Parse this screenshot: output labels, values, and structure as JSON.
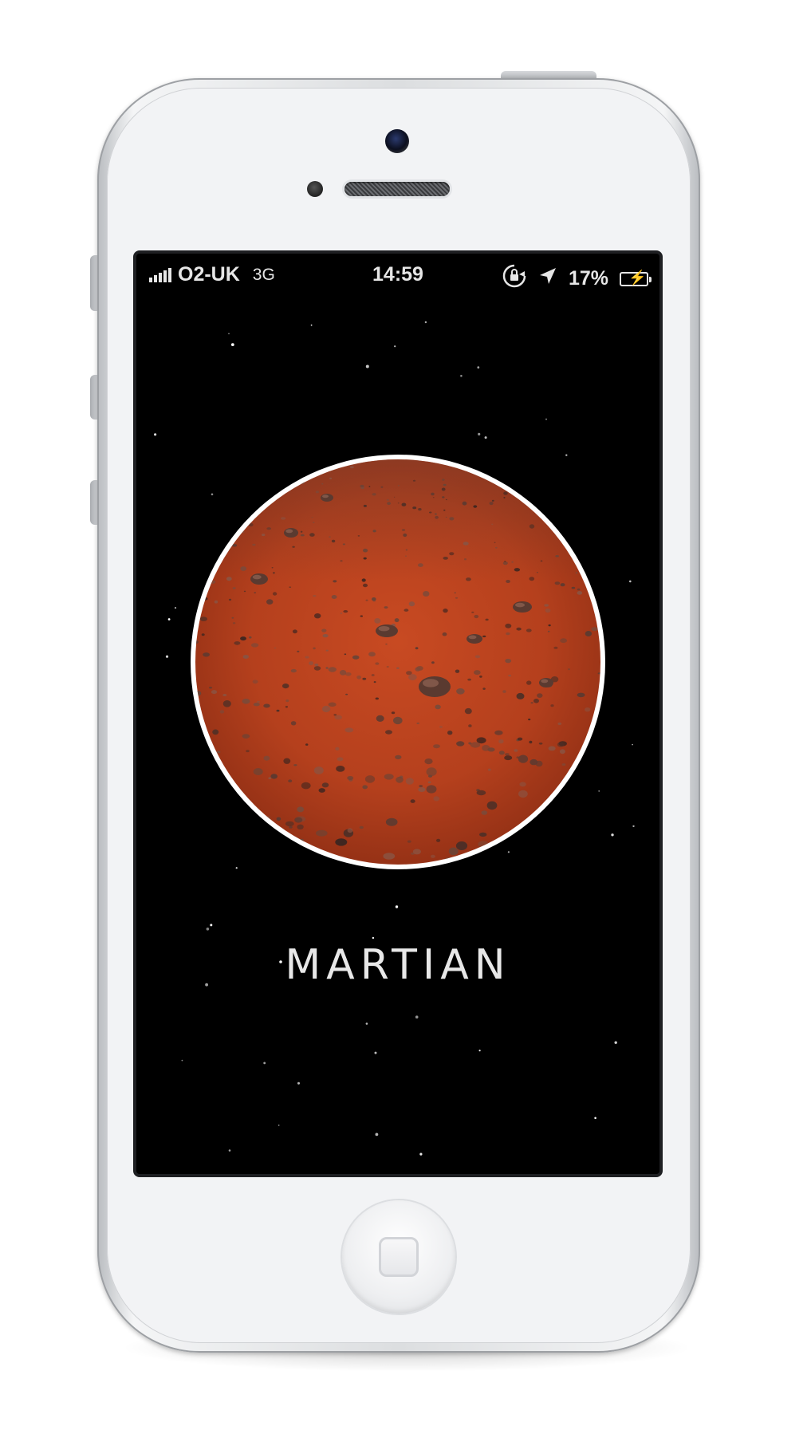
{
  "status_bar": {
    "carrier": "O2-UK",
    "network": "3G",
    "time": "14:59",
    "battery_percent": "17%"
  },
  "app": {
    "title": "MARTIAN"
  },
  "icons": {
    "signal": "signal-bars-icon",
    "rotation_lock": "rotation-lock-icon",
    "location": "location-arrow-icon",
    "battery": "battery-charging-icon"
  },
  "colors": {
    "screen_background": "#000000",
    "mars_surface": "#b8421f",
    "ring": "#ffffff",
    "text": "#e8e8e8"
  }
}
